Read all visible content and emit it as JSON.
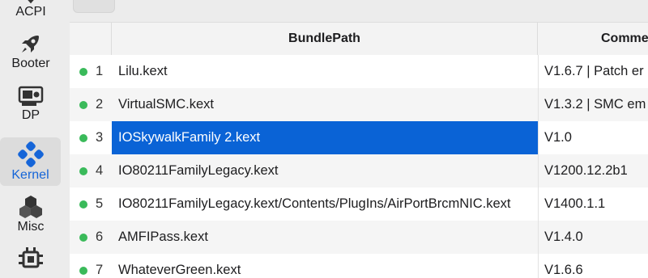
{
  "sidebar": {
    "items": [
      {
        "label": "ACPI",
        "icon": "acpi-icon",
        "active": false
      },
      {
        "label": "Booter",
        "icon": "rocket-icon",
        "active": false
      },
      {
        "label": "DP",
        "icon": "gpu-card-icon",
        "active": false
      },
      {
        "label": "Kernel",
        "icon": "atom-icon",
        "active": true
      },
      {
        "label": "Misc",
        "icon": "cubes-icon",
        "active": false
      },
      {
        "label": "",
        "icon": "chip-icon",
        "active": false
      }
    ]
  },
  "table": {
    "headers": {
      "index": "",
      "bundle_path": "BundlePath",
      "comment": "Comme"
    },
    "rows": [
      {
        "index": "1",
        "bundle_path": "Lilu.kext",
        "comment": "V1.6.7 | Patch er",
        "enabled": true,
        "selected": false
      },
      {
        "index": "2",
        "bundle_path": "VirtualSMC.kext",
        "comment": "V1.3.2 | SMC em",
        "enabled": true,
        "selected": false
      },
      {
        "index": "3",
        "bundle_path": "IOSkywalkFamily 2.kext",
        "comment": "V1.0",
        "enabled": true,
        "selected": true
      },
      {
        "index": "4",
        "bundle_path": "IO80211FamilyLegacy.kext",
        "comment": "V1200.12.2b1",
        "enabled": true,
        "selected": false
      },
      {
        "index": "5",
        "bundle_path": "IO80211FamilyLegacy.kext/Contents/PlugIns/AirPortBrcmNIC.kext",
        "comment": "V1400.1.1",
        "enabled": true,
        "selected": false
      },
      {
        "index": "6",
        "bundle_path": "AMFIPass.kext",
        "comment": "V1.4.0",
        "enabled": true,
        "selected": false
      },
      {
        "index": "7",
        "bundle_path": "WhateverGreen.kext",
        "comment": "V1.6.6",
        "enabled": true,
        "selected": false
      }
    ]
  },
  "colors": {
    "accent": "#1565d8",
    "selection": "#0a63d6",
    "enabled_dot": "#3aba5a"
  }
}
